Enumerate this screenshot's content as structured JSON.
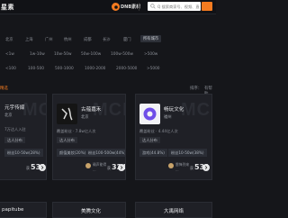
{
  "top": {
    "brand_text": "星素",
    "brand_logo_text": "DNB素材",
    "search_placeholder": "Q 搜索商家号、视频、直播间",
    "search_icon": "search-icon"
  },
  "filters": {
    "cities": [
      "北京",
      "上海",
      "广州",
      "杭州",
      "成都",
      "长沙",
      "厦门",
      "所有城市"
    ],
    "active_city": "所有城市",
    "row2": [
      "<1w",
      "1w-10w",
      "10w-50w",
      "50w-100w",
      "100w-500w",
      ">500w"
    ],
    "row3": [
      "<100",
      "100-500",
      "500-1000",
      "1000-2000",
      "2000-5000",
      ">5000"
    ]
  },
  "section": {
    "title": "精选",
    "sort_label": "排序：",
    "sort_value": "有帮助"
  },
  "cards": [
    {
      "name": "元宇传媒",
      "loc": "北京",
      "stat": "7万达人入驻",
      "badge": "达人分布",
      "metrics": [
        "粉丝10-50w(28%)"
      ],
      "mini_name": "",
      "mini_meta": "",
      "count": "531",
      "count_prefix": "获"
    },
    {
      "name": "古蕴嘉禾",
      "loc": "北京",
      "stat": "覆盖粉丝 · 7.8w亿人次",
      "badge": "达人分布",
      "metrics": [
        "颜值美妆(20%)",
        "粉丝100-500w(44%)"
      ],
      "mini_name": "确声能得",
      "mini_meta": "...",
      "count": "324",
      "count_prefix": "获"
    },
    {
      "name": "畅玩文化",
      "loc": "福州",
      "stat": "覆盖粉丝 · 4.44亿人次",
      "badge": "达人分布",
      "metrics": [
        "游戏(44.8%)",
        "粉丝10-50w(38%)"
      ],
      "mini_name": "雷锋到来",
      "mini_meta": "...",
      "count": "531",
      "count_prefix": "获"
    }
  ],
  "bottom": [
    {
      "name": "papitube"
    },
    {
      "name": "美腾文化"
    },
    {
      "name": "大禹网络"
    }
  ],
  "colors": {
    "accent": "#f47b20",
    "background": "#15161a"
  }
}
